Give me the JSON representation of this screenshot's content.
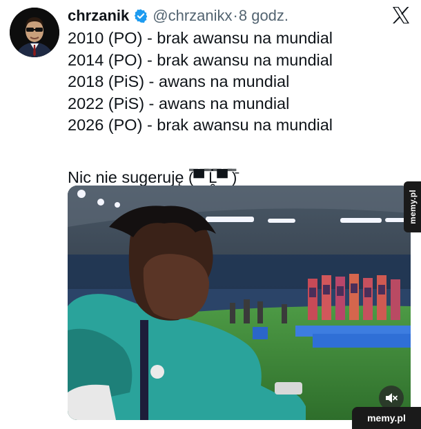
{
  "author": {
    "name": "chrzanik",
    "handle": "@chrzanikx",
    "separator": "·",
    "time": "8 godz."
  },
  "icons": {
    "verified": "verified-badge-icon",
    "x_logo": "x-logo-icon",
    "mute": "speaker-muted-icon"
  },
  "tweet": {
    "lines": [
      "2010 (PO) - brak awansu na mundial",
      "2014 (PO) - brak awansu na mundial",
      "2018 (PiS) - awans na mundial",
      "2022 (PiS) - awans na mundial",
      "2026 (PO) - brak awansu na mundial"
    ],
    "closing": "Nic nie sugeruję",
    "face": "(̿▀̿ ̿Ĺ̯̿̿▀̿ ̿)̄"
  },
  "watermark": {
    "side": "memy.pl",
    "bottom": "memy.pl"
  },
  "colors": {
    "verified": "#1d9bf0",
    "handle": "#536471",
    "text": "#0f1419",
    "pitch": "#3f8a3a",
    "jersey": "#2aa39b"
  }
}
